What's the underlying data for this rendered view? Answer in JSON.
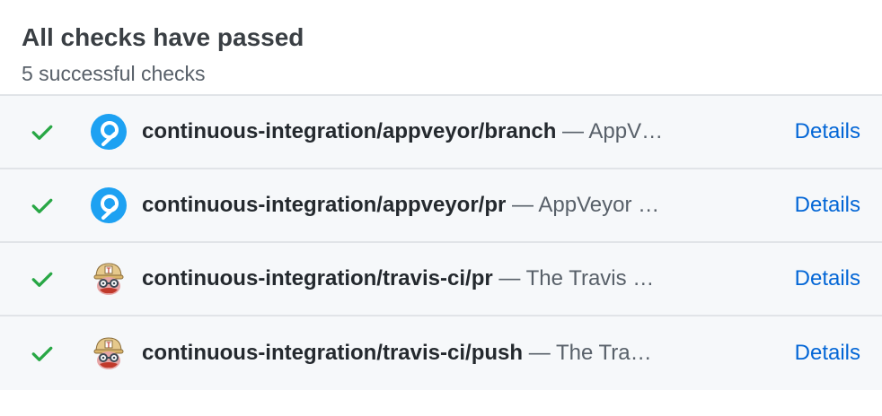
{
  "header": {
    "title": "All checks have passed",
    "subtitle": "5 successful checks"
  },
  "colors": {
    "success": "#28a745",
    "link": "#0366d6",
    "appveyor": "#1da1f2",
    "row_bg": "#f6f8fa",
    "border": "#e1e4e8"
  },
  "checks": [
    {
      "name": "continuous-integration/appveyor/branch",
      "description": "— AppV…",
      "details_label": "Details",
      "icon": "appveyor-icon",
      "status_icon": "check-icon"
    },
    {
      "name": "continuous-integration/appveyor/pr",
      "description": "— AppVeyor …",
      "details_label": "Details",
      "icon": "appveyor-icon",
      "status_icon": "check-icon"
    },
    {
      "name": "continuous-integration/travis-ci/pr",
      "description": "— The Travis …",
      "details_label": "Details",
      "icon": "travis-ci-icon",
      "status_icon": "check-icon"
    },
    {
      "name": "continuous-integration/travis-ci/push",
      "description": "— The Tra…",
      "details_label": "Details",
      "icon": "travis-ci-icon",
      "status_icon": "check-icon"
    }
  ]
}
